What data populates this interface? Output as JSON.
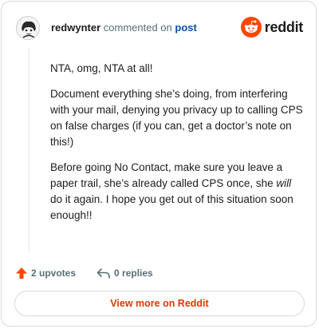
{
  "header": {
    "username": "redwynter",
    "commented_on": "commented on",
    "post_link": "post",
    "logo_text": "reddit"
  },
  "comment": {
    "paragraphs": [
      "NTA, omg, NTA at all!",
      "Document everything she’s doing, from interfering with your mail, denying you privacy up to calling CPS on false charges (if you can, get a doctor’s note on this!)"
    ],
    "last_paragraph_before": "Before going No Contact, make sure you leave a paper trail, she’s already called CPS once, she ",
    "last_paragraph_emphasis": "will",
    "last_paragraph_after": " do it again. I hope you get out of this situation soon enough!!"
  },
  "actions": {
    "upvotes_label": "2 upvotes",
    "replies_label": "0 replies"
  },
  "view_more_label": "View more on Reddit",
  "colors": {
    "brand": "#ff4500",
    "view_more_text": "#d93a00",
    "post_link": "#0a4ea3",
    "muted": "#576f76"
  },
  "icons": {
    "avatar": "user-avatar",
    "logo": "reddit-snoo-icon",
    "upvote": "upvote-arrow-icon",
    "reply": "reply-arrow-icon"
  }
}
